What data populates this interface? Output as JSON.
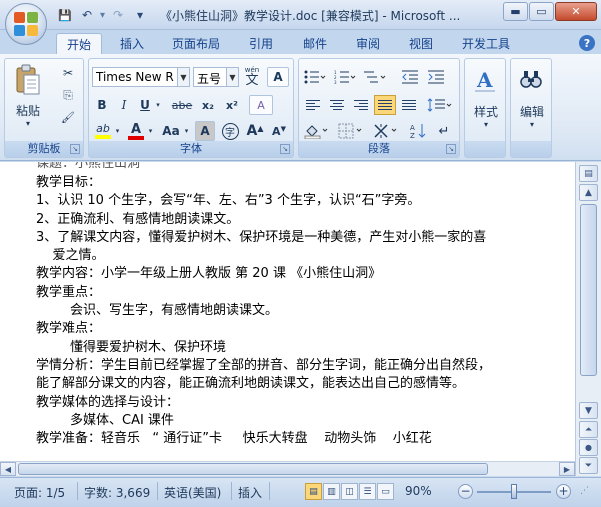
{
  "window": {
    "title": "《小熊住山洞》教学设计.doc [兼容模式] - Microsoft ...",
    "min_glyph": "▬",
    "max_glyph": "▭",
    "close_glyph": "✕"
  },
  "qat": {
    "save_glyph": "💾",
    "undo_glyph": "↶",
    "redo_glyph": "↷",
    "customize_glyph": "▾"
  },
  "tabs": [
    "开始",
    "插入",
    "页面布局",
    "引用",
    "邮件",
    "审阅",
    "视图",
    "开发工具"
  ],
  "help_glyph": "?",
  "ribbon": {
    "clipboard": {
      "label": "剪贴板",
      "paste_label": "粘贴",
      "cut_glyph": "✂",
      "copy_glyph": "⎘",
      "format_painter_glyph": "🖌"
    },
    "font": {
      "label": "字体",
      "font_name": "Times New R",
      "font_size": "五号",
      "phonetic_glyph": "文",
      "phonetic_ruby": "wén",
      "border_char_glyph": "A",
      "bold": "B",
      "italic": "I",
      "underline": "U",
      "strike": "abe",
      "subscript": "x₂",
      "superscript": "x²",
      "clear_format_glyph": "A",
      "highlight_glyph": "ab",
      "font_color_glyph": "A",
      "change_case": "Aa",
      "char_shading_glyph": "A",
      "enclose_char_glyph": "字",
      "grow_font": "A",
      "shrink_font": "A",
      "highlight_color": "#ffff00",
      "font_color": "#e00000"
    },
    "paragraph": {
      "label": "段落"
    },
    "styles": {
      "label": "样式"
    },
    "editing": {
      "label": "编辑"
    }
  },
  "document": {
    "top_cut": "课题：小熊住山洞",
    "lines": [
      "教学目标：",
      "1、认识 10 个生字，会写“年、左、右”3 个生字，认识“石”字旁。",
      "2、正确流利、有感情地朗读课文。",
      "3、了解课文内容，懂得爱护树木、保护环境是一种美德，产生对小熊一家的喜",
      "    爱之情。",
      "教学内容：小学一年级上册人教版  第 20 课  《小熊住山洞》",
      "教学重点：",
      "会识、写生字，有感情地朗读课文。",
      "教学难点：",
      "懂得要爱护树木、保护环境",
      "学情分析：学生目前已经掌握了全部的拼音、部分生字词，能正确分出自然段，",
      "能了解部分课文的内容，能正确流利地朗读课文，能表达出自己的感情等。",
      "教学媒体的选择与设计：",
      "多媒体、CAI 课件",
      "教学准备：轻音乐   “ 通行证”卡     快乐大转盘    动物头饰    小红花"
    ]
  },
  "statusbar": {
    "page": "页面: 1/5",
    "words": "字数: 3,669",
    "language": "英语(美国)",
    "mode": "插入",
    "zoom": "90%",
    "zoom_level": 90
  }
}
